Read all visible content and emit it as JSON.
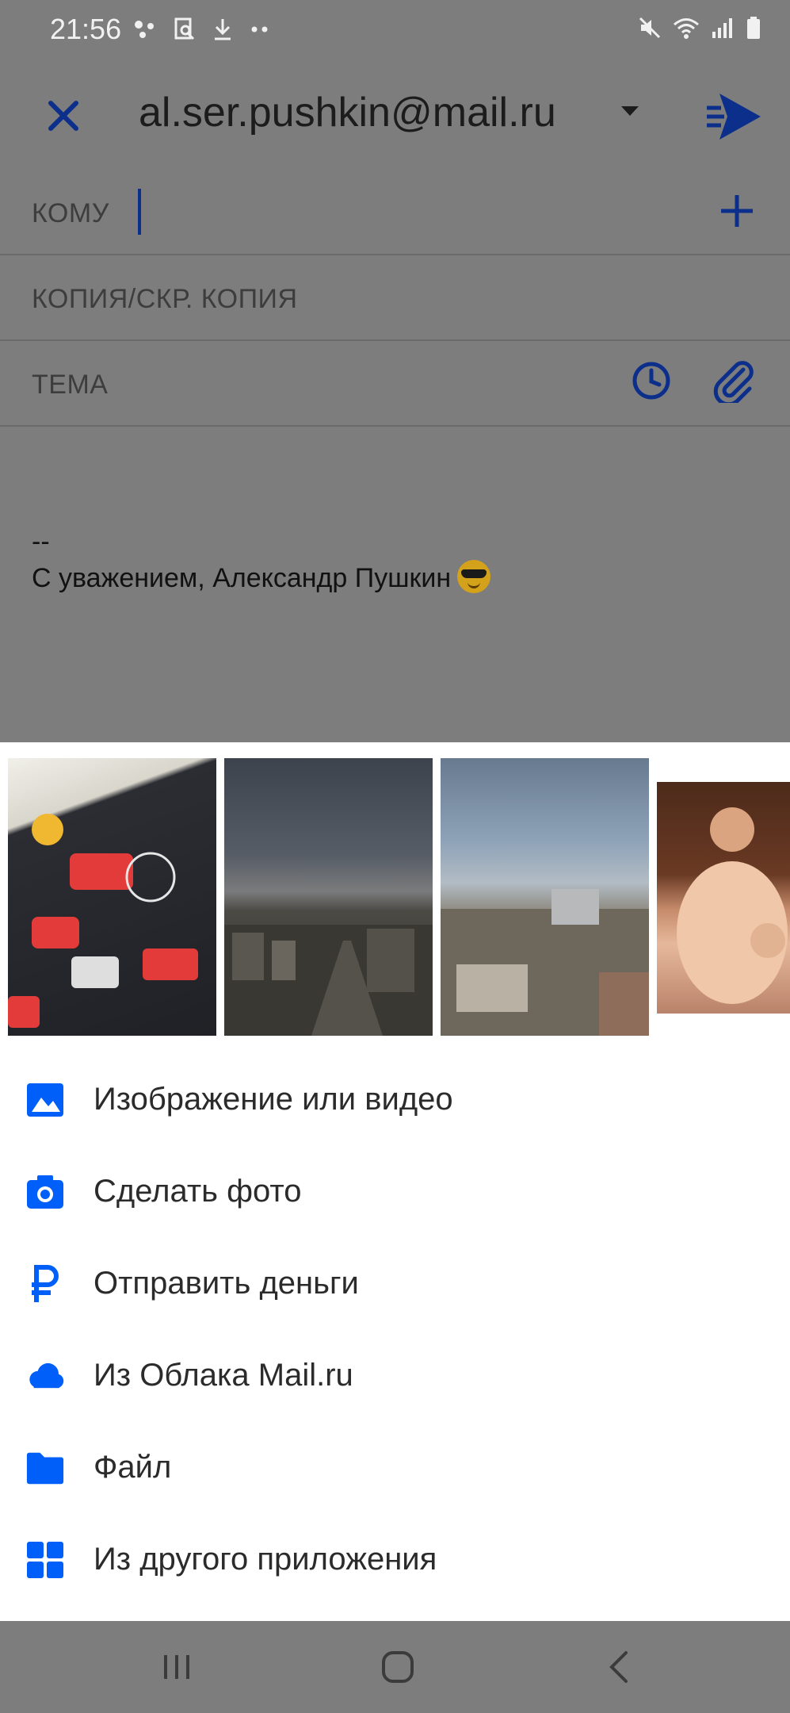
{
  "status_bar": {
    "time": "21:56"
  },
  "compose": {
    "from_email": "al.ser.pushkin@mail.ru",
    "to_label": "КОМУ",
    "cc_label": "КОПИЯ/СКР. КОПИЯ",
    "subject_label": "ТЕМА",
    "signature_dash": "--",
    "signature_text": "С уважением, Александр Пушкин"
  },
  "attach_sheet": {
    "options": [
      {
        "label": "Изображение или видео",
        "icon": "image-icon"
      },
      {
        "label": "Сделать фото",
        "icon": "camera-icon"
      },
      {
        "label": "Отправить деньги",
        "icon": "ruble-icon"
      },
      {
        "label": "Из Облака Mail.ru",
        "icon": "cloud-icon"
      },
      {
        "label": "Файл",
        "icon": "folder-icon"
      },
      {
        "label": "Из другого приложения",
        "icon": "apps-grid-icon"
      }
    ]
  },
  "colors": {
    "accent": "#005ff9",
    "dim_overlay": "#7d7d7d",
    "dim_accent": "#0b2f8a"
  }
}
